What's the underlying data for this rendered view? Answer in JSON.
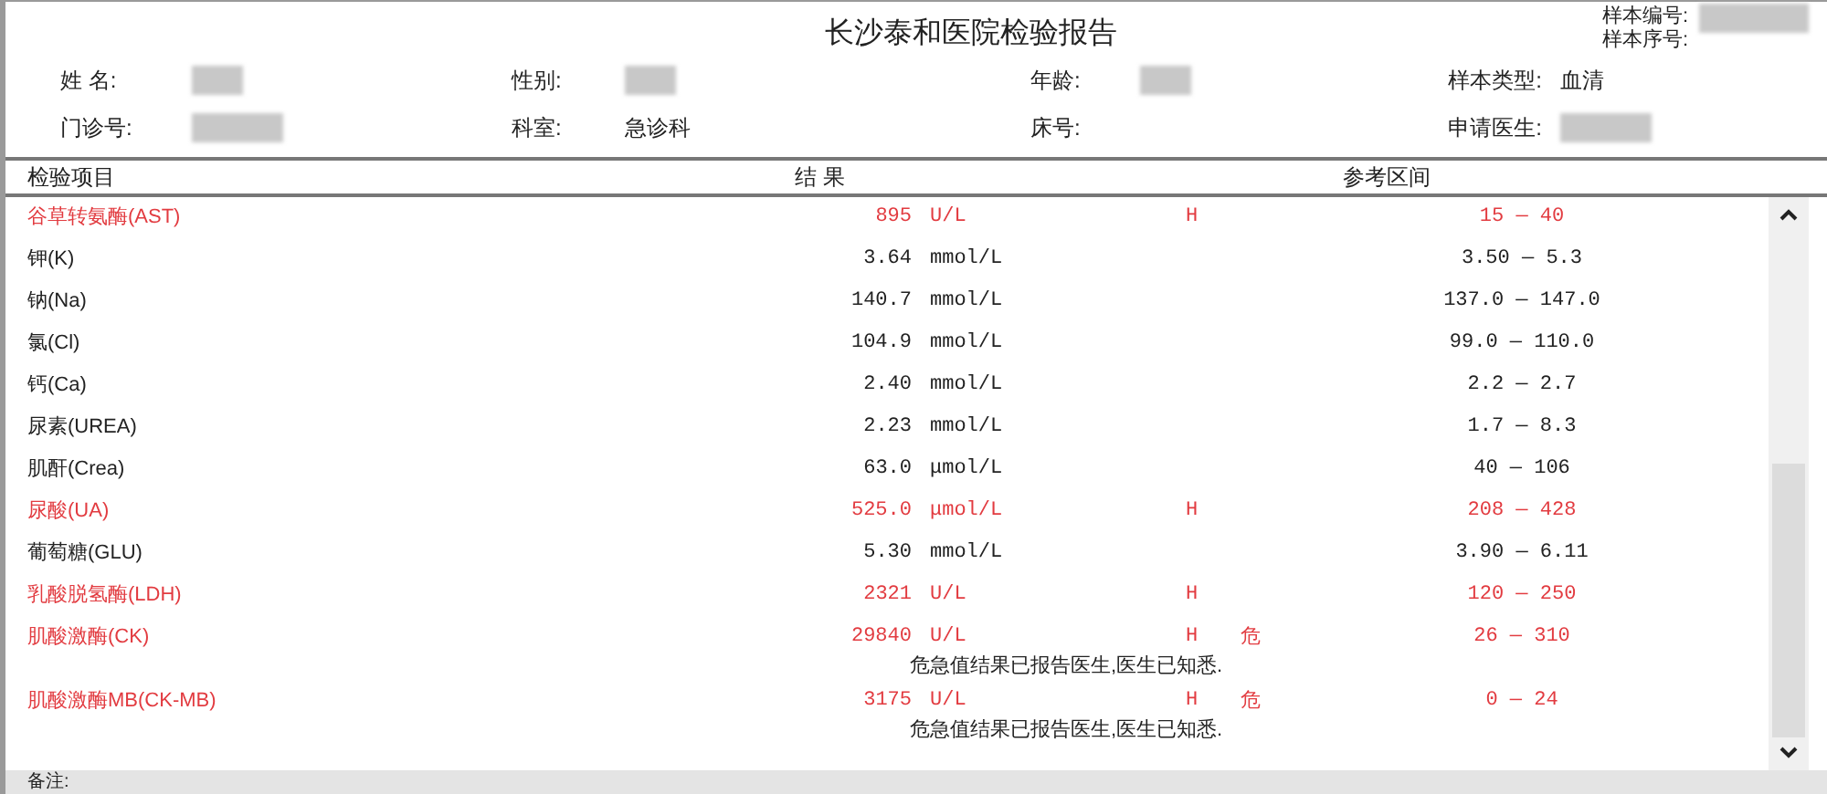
{
  "report": {
    "title": "长沙泰和医院检验报告",
    "sample_info": [
      {
        "label": "样本编号:",
        "redacted": true
      },
      {
        "label": "样本序号:",
        "redacted": false
      }
    ],
    "patient_fields": [
      [
        {
          "label": "姓 名:",
          "redacted": true
        },
        {
          "label": "性别:",
          "redacted": true
        },
        {
          "label": "年龄:",
          "redacted": true
        },
        {
          "label": "样本类型:",
          "value": "血清",
          "redacted": false
        }
      ],
      [
        {
          "label": "门诊号:",
          "redacted": true
        },
        {
          "label": "科室:",
          "value": "急诊科",
          "redacted": false
        },
        {
          "label": "床号:",
          "redacted": false
        },
        {
          "label": "申请医生:",
          "redacted": true
        }
      ]
    ],
    "columns": [
      "检验项目",
      "结 果",
      "参考区间"
    ],
    "rows": [
      {
        "name": "谷草转氨酶(AST)",
        "result": "895",
        "unit": "U/L",
        "flag": "H",
        "range": "15 — 40",
        "abnormal": true
      },
      {
        "name": "钾(K)",
        "result": "3.64",
        "unit": "mmol/L",
        "range": "3.50 — 5.3",
        "abnormal": false
      },
      {
        "name": "钠(Na)",
        "result": "140.7",
        "unit": "mmol/L",
        "range": "137.0 — 147.0",
        "abnormal": false
      },
      {
        "name": "氯(Cl)",
        "result": "104.9",
        "unit": "mmol/L",
        "range": "99.0 — 110.0",
        "abnormal": false
      },
      {
        "name": "钙(Ca)",
        "result": "2.40",
        "unit": "mmol/L",
        "range": "2.2 — 2.7",
        "abnormal": false
      },
      {
        "name": "尿素(UREA)",
        "result": "2.23",
        "unit": "mmol/L",
        "range": "1.7 — 8.3",
        "abnormal": false
      },
      {
        "name": "肌酐(Crea)",
        "result": "63.0",
        "unit": "μmol/L",
        "range": "40 — 106",
        "abnormal": false
      },
      {
        "name": "尿酸(UA)",
        "result": "525.0",
        "unit": "μmol/L",
        "flag": "H",
        "range": "208 — 428",
        "abnormal": true
      },
      {
        "name": "葡萄糖(GLU)",
        "result": "5.30",
        "unit": "mmol/L",
        "range": "3.90 — 6.11",
        "abnormal": false
      },
      {
        "name": "乳酸脱氢酶(LDH)",
        "result": "2321",
        "unit": "U/L",
        "flag": "H",
        "range": "120 — 250",
        "abnormal": true
      },
      {
        "name": "肌酸激酶(CK)",
        "result": "29840",
        "unit": "U/L",
        "flag": "H",
        "critical": "危",
        "range": "26 — 310",
        "abnormal": true,
        "note": "危急值结果已报告医生,医生已知悉."
      },
      {
        "name": "肌酸激酶MB(CK-MB)",
        "result": "3175",
        "unit": "U/L",
        "flag": "H",
        "critical": "危",
        "range": "0 — 24",
        "abnormal": true,
        "note": "危急值结果已报告医生,医生已知悉."
      }
    ],
    "remarks_label": "备注:"
  }
}
